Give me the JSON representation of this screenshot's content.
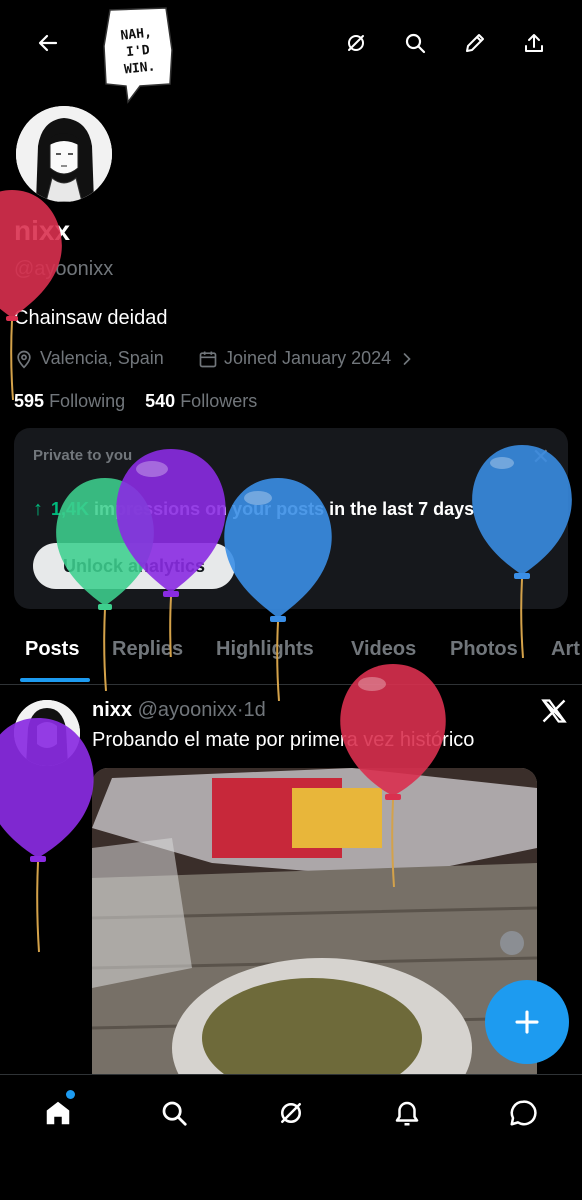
{
  "header": {
    "speech_bubble": [
      "NAH,",
      "I'D",
      "WIN."
    ]
  },
  "profile": {
    "name": "nixx",
    "handle": "@ayoonixx",
    "bio": "Chainsaw deidad",
    "location": "Valencia, Spain",
    "joined": "Joined January 2024",
    "following_count": "595",
    "following_label": "Following",
    "followers_count": "540",
    "followers_label": "Followers"
  },
  "analytics_card": {
    "label": "Private to you",
    "impressions": "1,4K",
    "impressions_text": "impressions on your posts in the last 7 days",
    "button_label": "Unlock analytics"
  },
  "tabs": [
    "Posts",
    "Replies",
    "Highlights",
    "Videos",
    "Photos",
    "Art"
  ],
  "active_tab": "Posts",
  "post": {
    "author": "nixx",
    "handle": "@ayoonixx",
    "separator": "·",
    "time": "1d",
    "text": "Probando el mate por primera vez histórico"
  },
  "colors": {
    "accent": "#1d9bf0",
    "green": "#00ba7c",
    "balloon_red": "#d9304f",
    "balloon_purple": "#8a2be2",
    "balloon_green": "#3ecf8e",
    "balloon_blue": "#3a8ee6"
  },
  "icons": {
    "back": "arrow-left-icon",
    "grok": "grok-icon",
    "search": "search-icon",
    "edit": "pencil-icon",
    "share": "share-icon",
    "location": "location-pin-icon",
    "calendar": "calendar-icon",
    "compose": "plus-icon"
  }
}
